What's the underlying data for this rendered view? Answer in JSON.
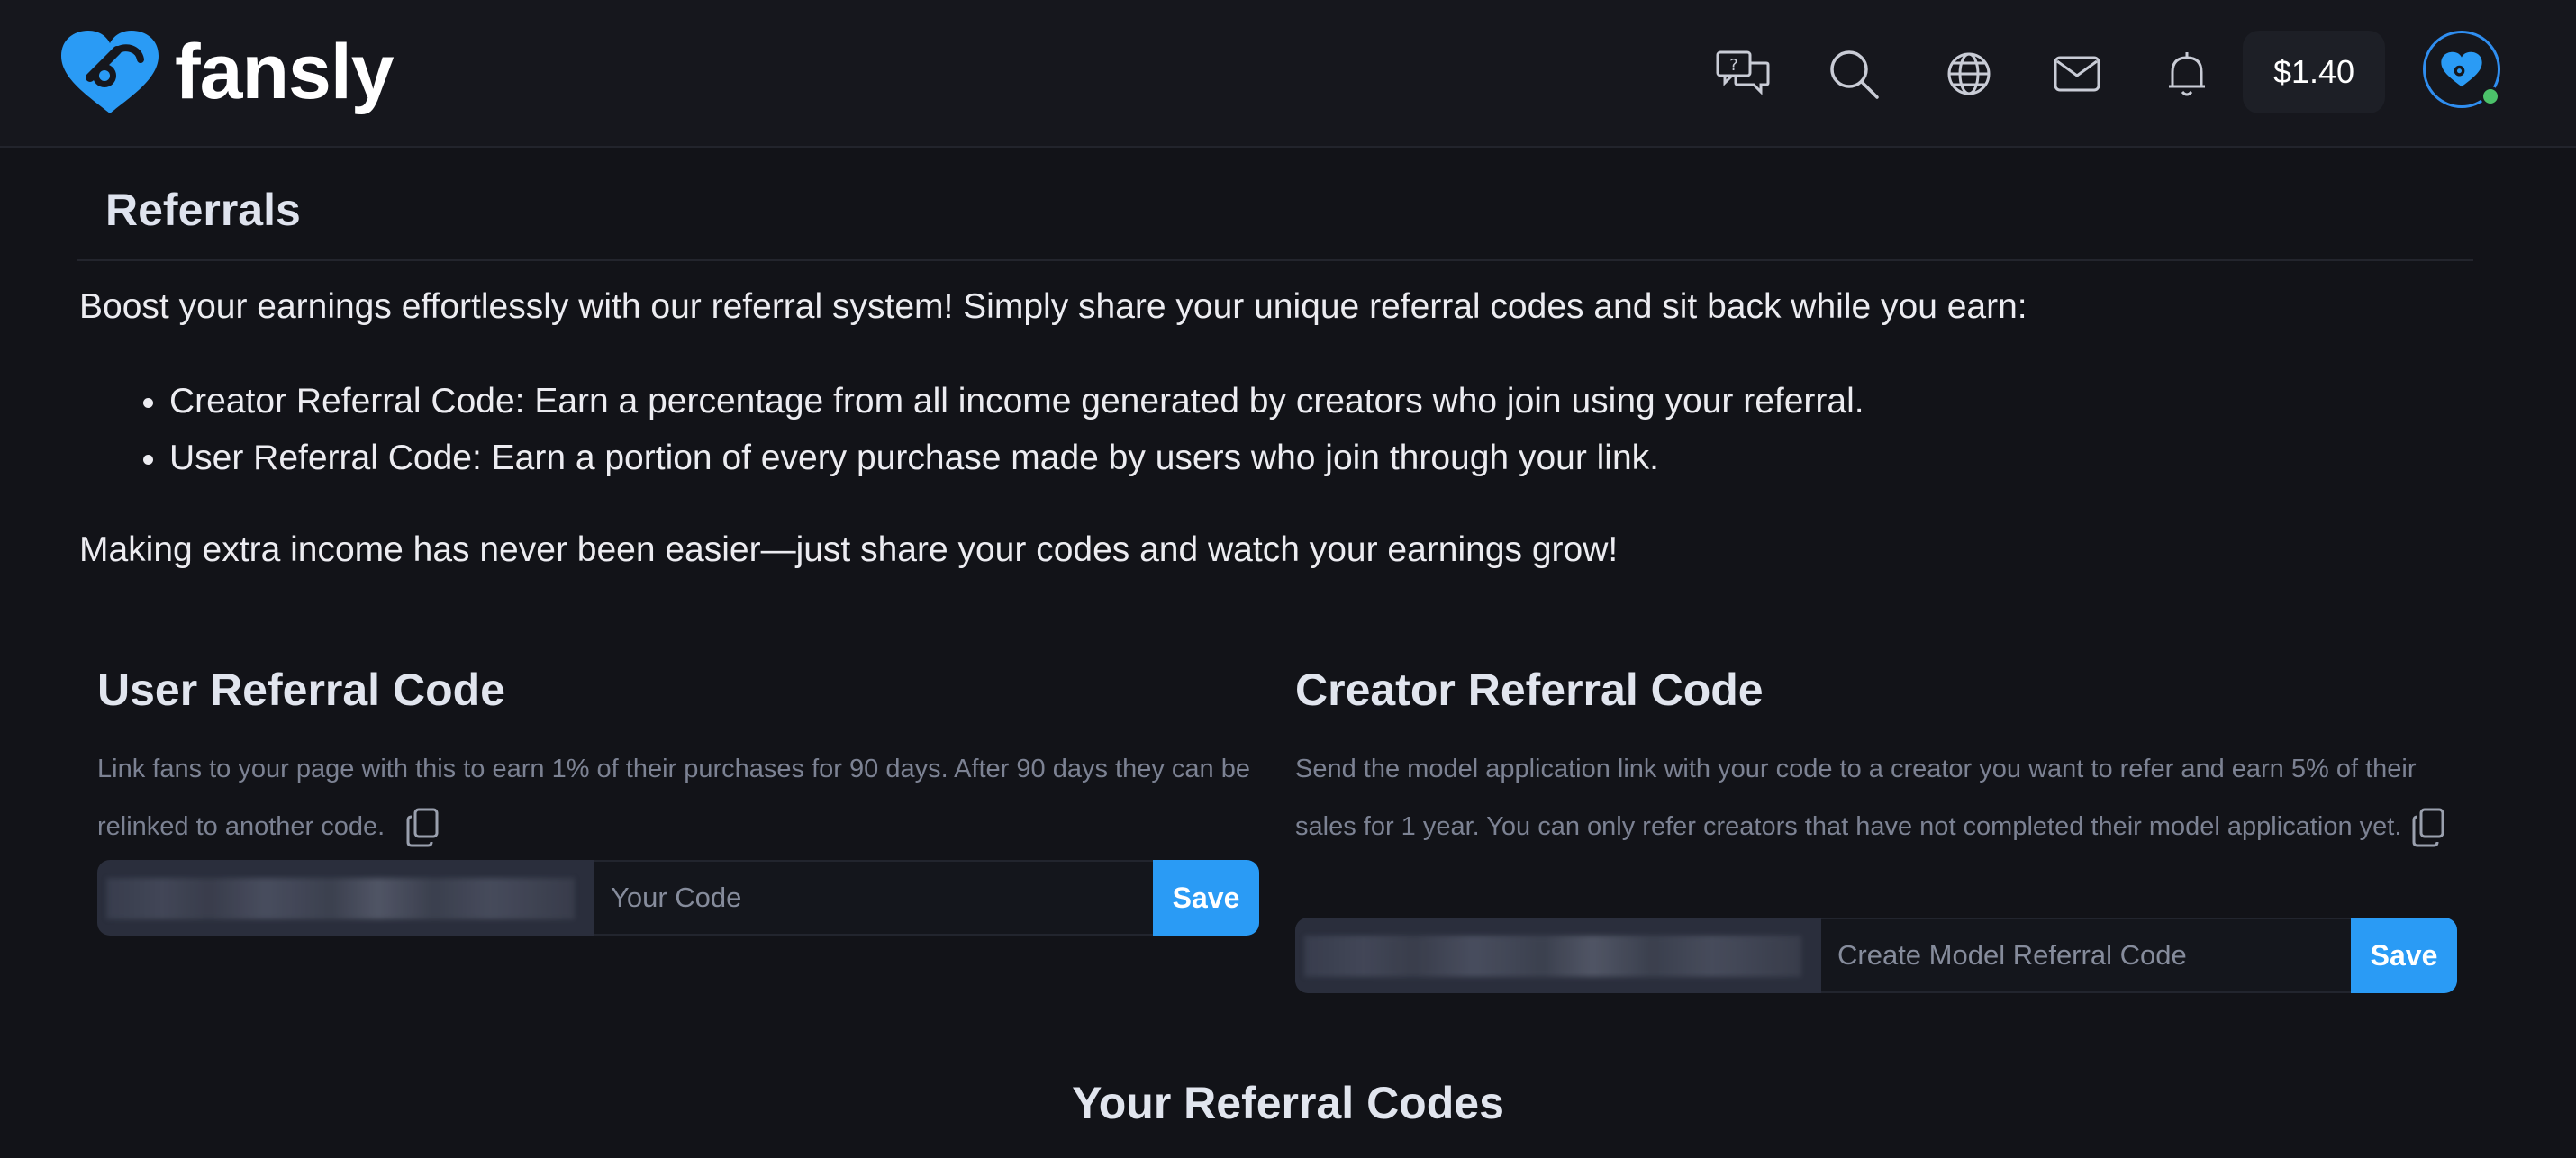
{
  "header": {
    "brand_name": "fansly",
    "icons": [
      "support-chat-icon",
      "search-icon",
      "globe-icon",
      "mail-icon",
      "bell-icon"
    ],
    "balance": "$1.40",
    "avatar_status": "online",
    "accent_color": "#2a9bf5"
  },
  "page": {
    "title": "Referrals",
    "intro": "Boost your earnings effortlessly with our referral system! Simply share your unique referral codes and sit back while you earn:",
    "bullets": [
      "Creator Referral Code: Earn a percentage from all income generated by creators who join using your referral.",
      "User Referral Code: Earn a portion of every purchase made by users who join through your link."
    ],
    "outro": "Making extra income has never been easier—just share your codes and watch your earnings grow!"
  },
  "user_referral": {
    "title": "User Referral Code",
    "description": "Link fans to your page with this to earn 1% of their purchases for 90 days. After 90 days they can be relinked to another code.",
    "input_placeholder": "Your Code",
    "input_value": "",
    "save_label": "Save"
  },
  "creator_referral": {
    "title": "Creator Referral Code",
    "description": "Send the model application link with your code to a creator you want to refer and earn 5% of their sales for 1 year. You can only refer creators that have not completed their model application yet.",
    "input_placeholder": "Create Model Referral Code",
    "input_value": "",
    "save_label": "Save"
  },
  "codes_section": {
    "title": "Your Referral Codes"
  }
}
